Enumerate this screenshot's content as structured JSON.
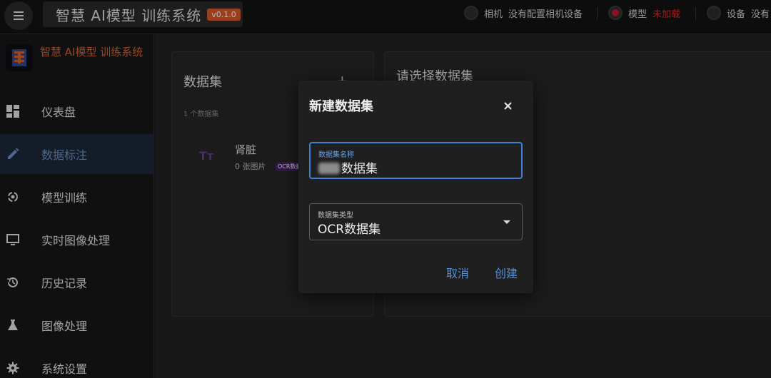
{
  "topbar": {
    "app_title": "智慧 AI模型 训练系统",
    "version": "v0.1.0",
    "status": [
      {
        "label": "相机",
        "value": "没有配置相机设备",
        "state": "off"
      },
      {
        "label": "模型",
        "value": "未加载",
        "state": "error"
      },
      {
        "label": "设备",
        "value": "没有",
        "state": "off"
      }
    ]
  },
  "sidebar": {
    "brand_name": "智慧 AI模型 训练系统",
    "items": [
      {
        "label": "仪表盘",
        "icon": "dashboard-icon"
      },
      {
        "label": "数据标注",
        "icon": "pencil-icon",
        "active": true
      },
      {
        "label": "模型训练",
        "icon": "training-icon"
      },
      {
        "label": "实时图像处理",
        "icon": "monitor-icon"
      },
      {
        "label": "历史记录",
        "icon": "history-icon"
      },
      {
        "label": "图像处理",
        "icon": "flask-icon"
      },
      {
        "label": "系统设置",
        "icon": "gear-icon"
      }
    ]
  },
  "datasets_panel": {
    "title": "数据集",
    "add_label": "+",
    "count": "1 个数据集",
    "items": [
      {
        "name": "肾脏",
        "images": "0 张图片",
        "type_chip": "OCR数据集"
      }
    ]
  },
  "detail_panel": {
    "title": "请选择数据集"
  },
  "dialog": {
    "title": "新建数据集",
    "name_field": {
      "label": "数据集名称",
      "value": "数据集"
    },
    "type_field": {
      "label": "数据集类型",
      "value": "OCR数据集"
    },
    "cancel_label": "取消",
    "create_label": "创建"
  },
  "colors": {
    "accent": "#d9602e",
    "primary": "#3f7fd6",
    "error": "#c0182a",
    "background": "#1d1d1d"
  }
}
